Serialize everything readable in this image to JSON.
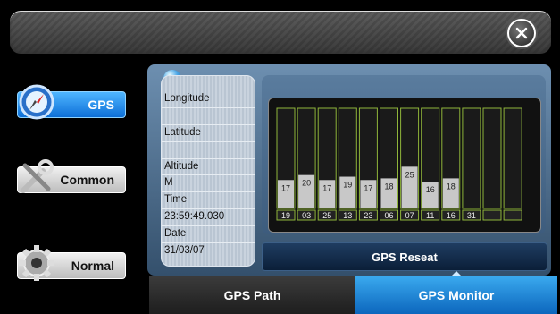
{
  "sidebar": {
    "items": [
      {
        "label": "GPS",
        "icon": "compass-icon",
        "active": true
      },
      {
        "label": "Common",
        "icon": "tools-icon",
        "active": false
      },
      {
        "label": "Normal",
        "icon": "gear-icon",
        "active": false
      }
    ]
  },
  "info": {
    "longitude_label": "Longitude",
    "longitude_value": "",
    "latitude_label": "Latitude",
    "latitude_value": "",
    "altitude_label": "Altitude",
    "altitude_value": "M",
    "time_label": "Time",
    "time_value": "23:59:49.030",
    "date_label": "Date",
    "date_value": "31/03/07"
  },
  "chart_data": {
    "type": "bar",
    "categories": [
      "19",
      "03",
      "25",
      "13",
      "23",
      "06",
      "07",
      "11",
      "16",
      "31",
      "",
      ""
    ],
    "values": [
      17,
      20,
      17,
      19,
      17,
      18,
      25,
      16,
      18,
      0,
      0,
      0
    ],
    "ylim": [
      0,
      60
    ]
  },
  "buttons": {
    "reset_label": "GPS Reseat"
  },
  "tabs": {
    "path_label": "GPS Path",
    "monitor_label": "GPS Monitor"
  },
  "colors": {
    "accent": "#1a87e0",
    "bar_fill": "#c8c8c8",
    "slot_outline": "#8fb53a"
  }
}
